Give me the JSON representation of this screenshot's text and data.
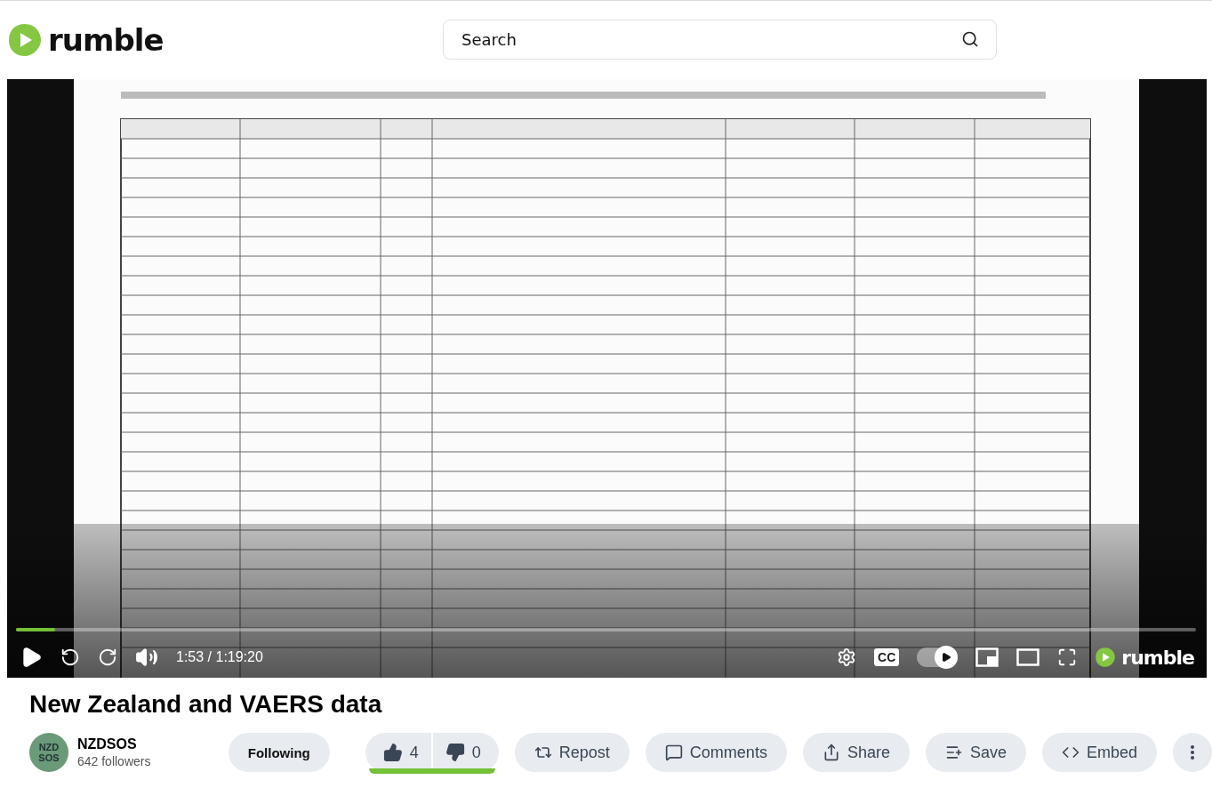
{
  "header": {
    "logo": "rumble",
    "search": {
      "placeholder": "Search"
    }
  },
  "player": {
    "progress": {
      "level": 0.033
    },
    "time": "1:53 / 1:19:20",
    "captions": "CC",
    "autoplay": {
      "on": true
    },
    "logo": "rumble"
  },
  "title": "New Zealand and VAERS data",
  "channel": {
    "avatar": [
      "NZD",
      "SOS"
    ],
    "name": "NZDSOS",
    "followers": "642 followers",
    "follow_button": "Following"
  },
  "rating": {
    "likes": "4",
    "dislikes": "0",
    "level": 1
  },
  "actions": [
    {
      "kind": "repost",
      "label": "Repost"
    },
    {
      "kind": "comments",
      "label": "Comments"
    },
    {
      "kind": "share",
      "label": "Share"
    },
    {
      "kind": "save",
      "label": "Save"
    },
    {
      "kind": "embed",
      "label": "Embed"
    }
  ]
}
